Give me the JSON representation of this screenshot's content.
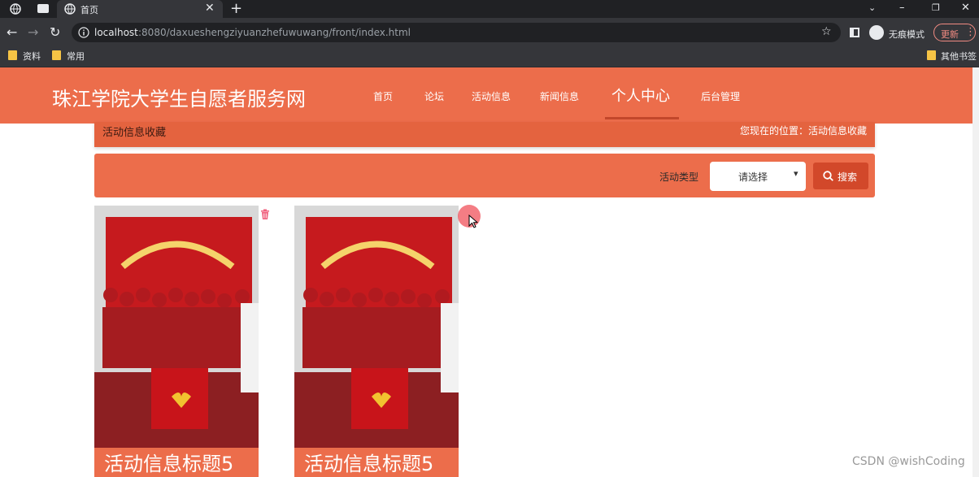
{
  "browser": {
    "tab_title": "首页",
    "url_host": "localhost",
    "url_rest": ":8080/daxueshengziyuanzhefuwuwang/front/index.html",
    "incognito_label": "无痕模式",
    "update_label": "更新",
    "bookmarks": [
      "资料",
      "常用"
    ],
    "other_bookmarks": "其他书签"
  },
  "site": {
    "title": "珠江学院大学生自愿者服务网",
    "nav": [
      "首页",
      "论坛",
      "活动信息",
      "新闻信息",
      "个人中心",
      "后台管理"
    ],
    "active_nav": "个人中心"
  },
  "breadcrumb": {
    "page_name": "活动信息收藏",
    "location": "您现在的位置：活动信息收藏"
  },
  "search": {
    "filter_label": "活动类型",
    "select_value": "请选择",
    "button_label": "搜索"
  },
  "cards": [
    {
      "title": "活动信息标题5"
    },
    {
      "title": "活动信息标题5"
    }
  ],
  "watermark": "CSDN @wishCoding",
  "colors": {
    "brand": "#ec6d4b",
    "brand_dark": "#e4633f",
    "button": "#d2482a"
  }
}
